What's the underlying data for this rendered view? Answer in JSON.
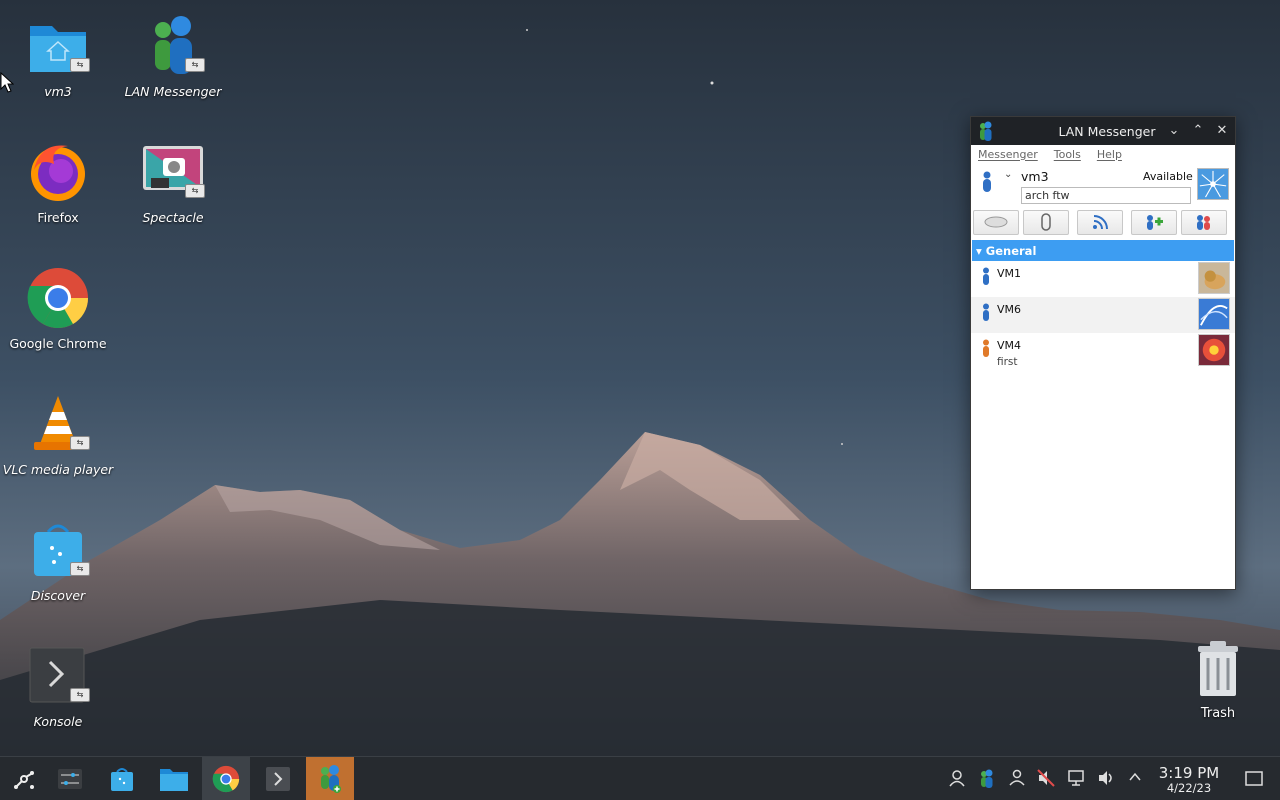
{
  "desktop": {
    "icons": [
      {
        "label": "vm3",
        "icon": "home-folder-icon"
      },
      {
        "label": "LAN Messenger",
        "icon": "lan-messenger-icon"
      },
      {
        "label": "Firefox",
        "icon": "firefox-icon"
      },
      {
        "label": "Spectacle",
        "icon": "spectacle-icon"
      },
      {
        "label": "Google Chrome",
        "icon": "chrome-icon"
      },
      {
        "label": "VLC media player",
        "icon": "vlc-icon"
      },
      {
        "label": "Discover",
        "icon": "discover-icon"
      },
      {
        "label": "Konsole",
        "icon": "konsole-icon"
      }
    ],
    "trash_label": "Trash"
  },
  "messenger": {
    "title": "LAN Messenger",
    "menu": [
      "Messenger",
      "Tools",
      "Help"
    ],
    "user": {
      "name": "vm3",
      "status": "Available",
      "note": "arch ftw"
    },
    "group": "General",
    "contacts": [
      {
        "name": "VM1",
        "note": "",
        "status_color": "#2f6fc4"
      },
      {
        "name": "VM6",
        "note": "",
        "status_color": "#2f6fc4"
      },
      {
        "name": "VM4",
        "note": "first",
        "status_color": "#e07a2a"
      }
    ]
  },
  "taskbar": {
    "apps": [
      "app-launcher-icon",
      "system-settings-icon",
      "discover-icon",
      "file-manager-icon",
      "chrome-icon",
      "konsole-icon",
      "lan-messenger-icon"
    ],
    "tray": [
      "user-icon",
      "lan-messenger-tray-icon",
      "network-users-icon",
      "muted-volume-icon",
      "network-icon",
      "volume-icon",
      "expand-tray-icon"
    ]
  },
  "clock": {
    "time": "3:19 PM",
    "date": "4/22/23"
  }
}
